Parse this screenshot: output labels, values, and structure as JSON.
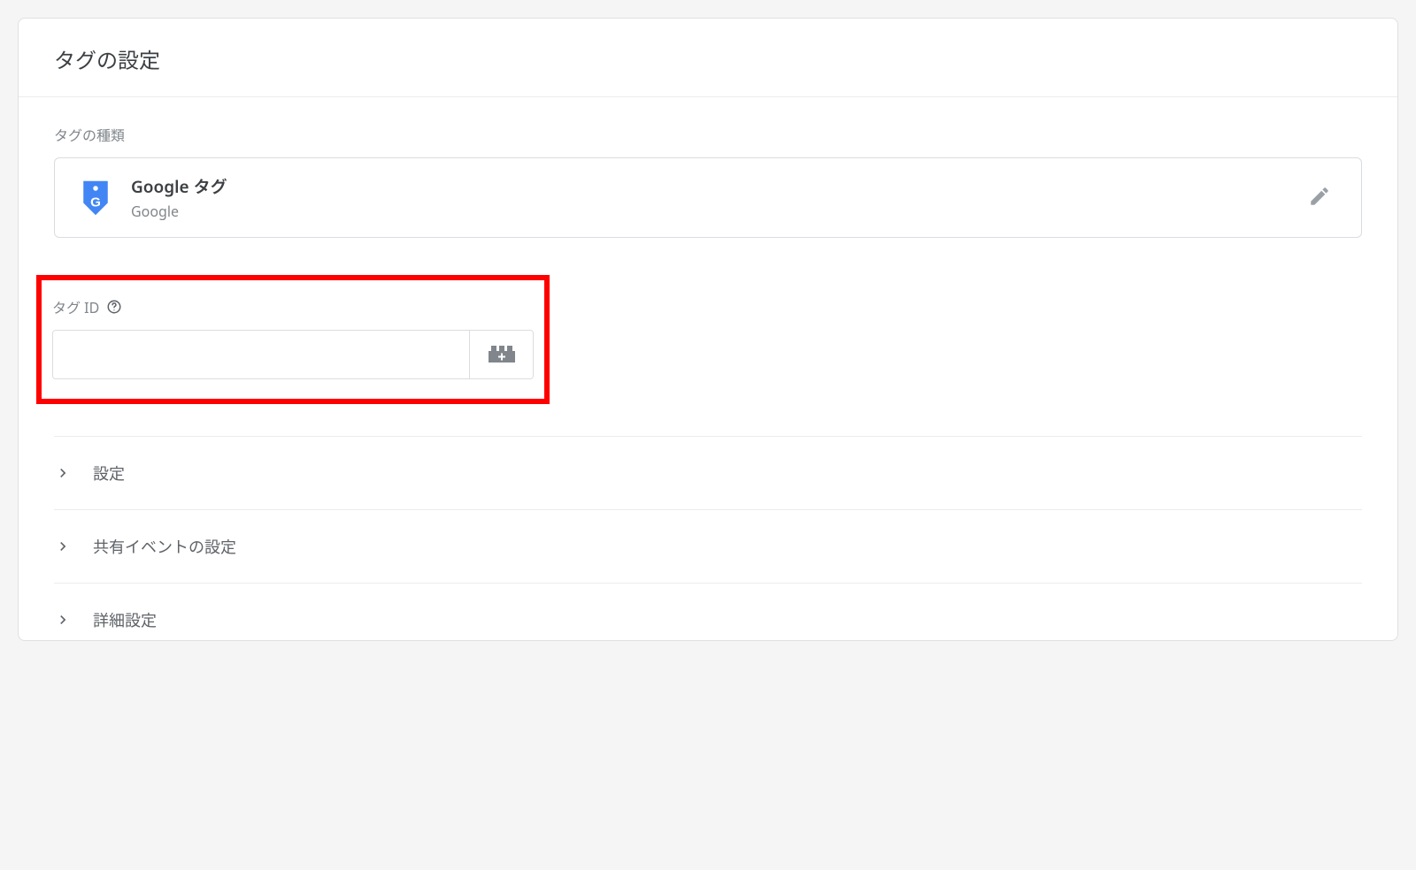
{
  "card": {
    "title": "タグの設定"
  },
  "tagType": {
    "sectionLabel": "タグの種類",
    "title": "Google タグ",
    "subtitle": "Google"
  },
  "tagId": {
    "label": "タグ ID",
    "value": ""
  },
  "accordion": {
    "items": [
      {
        "label": "設定"
      },
      {
        "label": "共有イベントの設定"
      },
      {
        "label": "詳細設定"
      }
    ]
  }
}
